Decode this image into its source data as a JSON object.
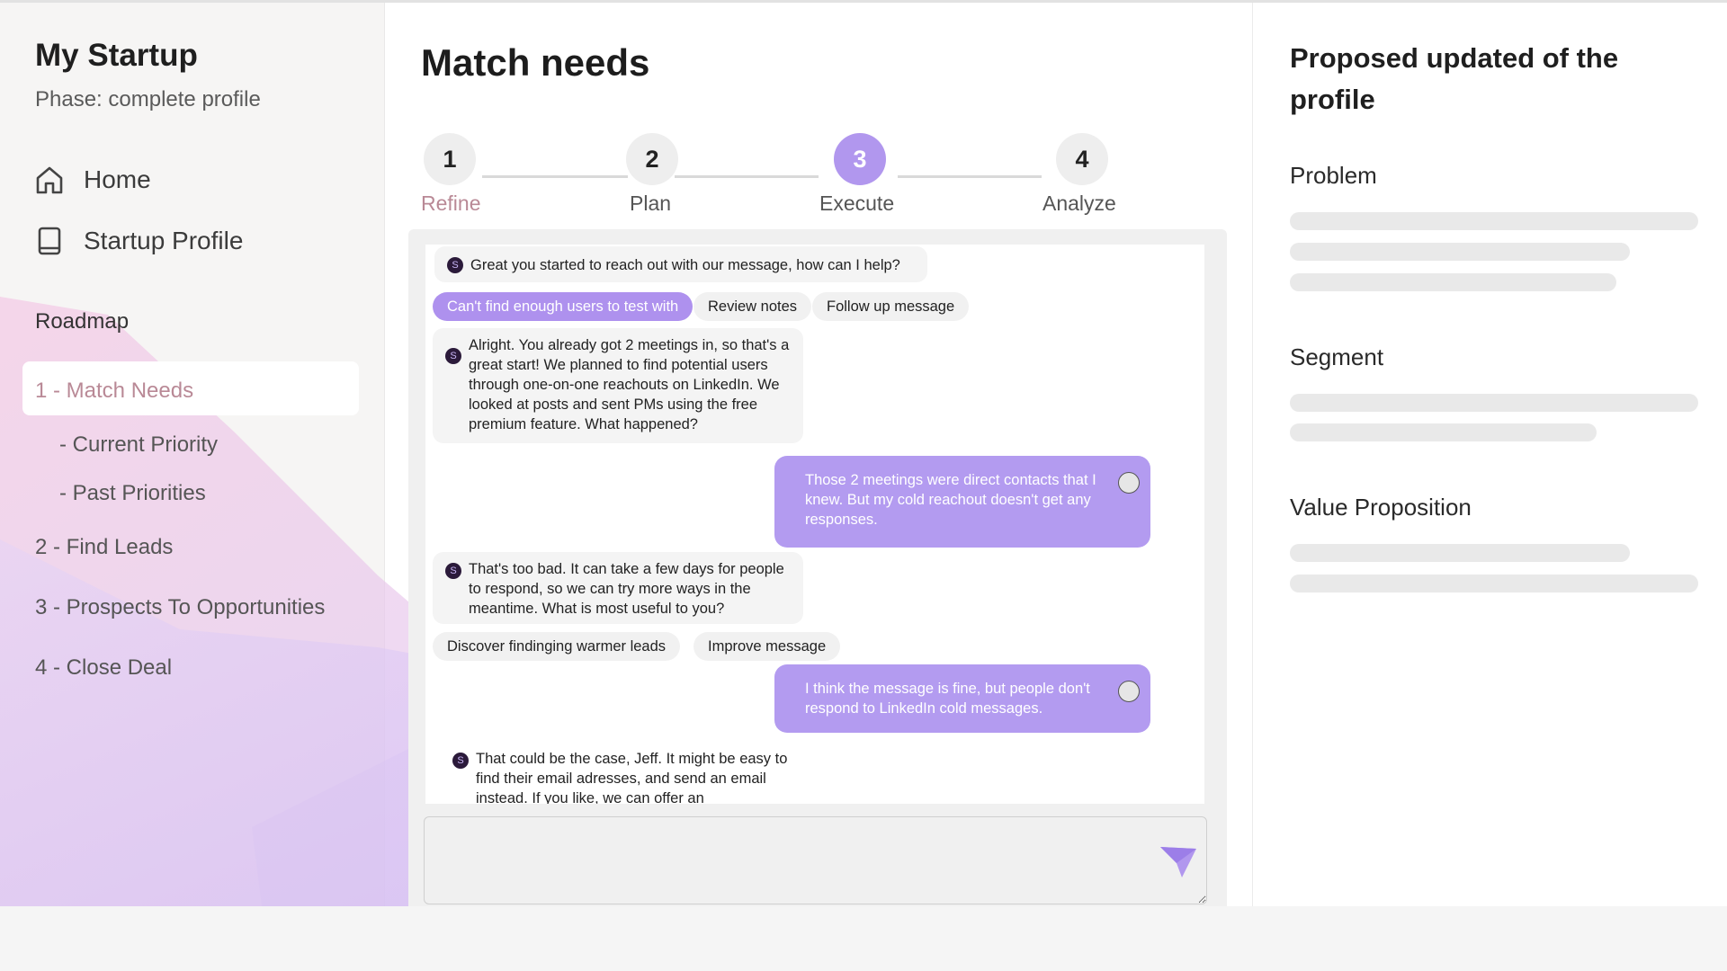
{
  "sidebar": {
    "brand": "My Startup",
    "phase": "Phase: complete profile",
    "nav": [
      {
        "label": "Home",
        "icon": "home-icon"
      },
      {
        "label": "Startup Profile",
        "icon": "book-icon"
      }
    ],
    "roadmap_heading": "Roadmap",
    "roadmap": [
      {
        "label": "1 - Match Needs",
        "active": true
      },
      {
        "label": "- Current Priority"
      },
      {
        "label": "- Past Priorities"
      },
      {
        "label": "2 - Find Leads"
      },
      {
        "label": "3 - Prospects To Opportunities"
      },
      {
        "label": "4 - Close Deal"
      }
    ]
  },
  "main": {
    "title": "Match needs",
    "steps": [
      {
        "number": "1",
        "label": "Refine"
      },
      {
        "number": "2",
        "label": "Plan"
      },
      {
        "number": "3",
        "label": "Execute",
        "active": true
      },
      {
        "number": "4",
        "label": "Analyze"
      }
    ],
    "chat": {
      "messages": [
        {
          "from": "bot",
          "text": "Great you started to reach out with our message, how can I help?"
        },
        {
          "from": "bot",
          "text": "Alright. You already got 2 meetings in, so that's a great start! We planned to find potential users through one-on-one reachouts on LinkedIn. We looked at posts and sent PMs using the free premium feature. What happened?"
        },
        {
          "from": "user",
          "text": "Those 2 meetings were direct contacts that I knew. But my cold reachout doesn't get any responses."
        },
        {
          "from": "bot",
          "text": "That's too bad. It can take a few days for people to respond, so we can try more ways in the meantime. What is most useful to you?"
        },
        {
          "from": "user",
          "text": "I think the message is fine, but people don't respond to LinkedIn cold messages."
        },
        {
          "from": "bot",
          "text": "That could be the case, Jeff. It might be easy to find their email adresses, and send an email instead. If you like, we can offer an"
        }
      ],
      "chips_1": [
        {
          "label": "Can't find enough users to test with",
          "selected": true
        },
        {
          "label": "Review notes"
        },
        {
          "label": "Follow up message"
        }
      ],
      "chips_2": [
        {
          "label": "Discover findinging warmer leads"
        },
        {
          "label": "Improve message"
        }
      ],
      "input_placeholder": ""
    }
  },
  "right_panel": {
    "title": "Proposed updated of the profile",
    "sections": [
      "Problem",
      "Segment",
      "Value Proposition"
    ]
  },
  "colors": {
    "accent": "#b197ee",
    "user_bubble": "#b39bf0",
    "active_roadmap_text": "#b98996"
  }
}
